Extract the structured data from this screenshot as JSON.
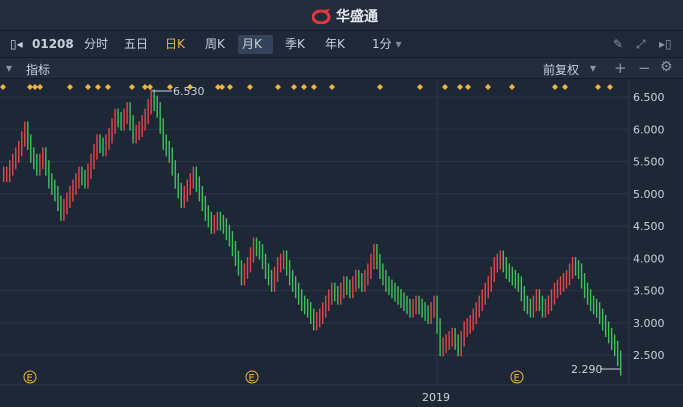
{
  "app": {
    "title": "华盛通"
  },
  "toolbar": {
    "code": "01208",
    "tabs": [
      {
        "label": "分时"
      },
      {
        "label": "五日"
      },
      {
        "label": "日K"
      },
      {
        "label": "周K"
      },
      {
        "label": "月K"
      },
      {
        "label": "季K"
      },
      {
        "label": "年K"
      }
    ],
    "interval": "1分",
    "active": "月K"
  },
  "indicator_bar": {
    "label": "指标",
    "adjust": "前复权"
  },
  "colors": {
    "up": "#e0474c",
    "down": "#3fbf5a",
    "marker": "#f0b43c",
    "bg": "#1e2736"
  },
  "chart_data": {
    "type": "candlestick",
    "y_ticks": [
      "6.500",
      "6.000",
      "5.500",
      "5.000",
      "4.500",
      "4.000",
      "3.500",
      "3.000",
      "2.500"
    ],
    "ylim": [
      2.2,
      6.6
    ],
    "x_label": "2019",
    "max_label": "6.530",
    "min_label": "2.290",
    "events": [
      "E",
      "E",
      "E"
    ],
    "closes": [
      5.3,
      5.5,
      5.7,
      6.0,
      5.6,
      5.4,
      5.6,
      5.2,
      5.0,
      4.7,
      4.9,
      5.1,
      5.3,
      5.2,
      5.5,
      5.8,
      5.7,
      5.9,
      6.2,
      6.1,
      6.3,
      5.9,
      6.0,
      6.2,
      6.5,
      6.3,
      5.8,
      5.6,
      5.2,
      4.9,
      5.1,
      5.3,
      5.0,
      4.7,
      4.5,
      4.6,
      4.5,
      4.3,
      4.0,
      3.7,
      3.9,
      4.2,
      4.1,
      3.8,
      3.6,
      3.9,
      4.0,
      3.7,
      3.5,
      3.3,
      3.2,
      3.0,
      3.1,
      3.3,
      3.5,
      3.4,
      3.6,
      3.5,
      3.7,
      3.6,
      3.8,
      4.1,
      3.8,
      3.6,
      3.5,
      3.4,
      3.3,
      3.2,
      3.3,
      3.2,
      3.1,
      3.3,
      2.6,
      2.7,
      2.8,
      2.6,
      2.9,
      3.0,
      3.2,
      3.4,
      3.6,
      3.9,
      4.0,
      3.8,
      3.7,
      3.6,
      3.3,
      3.2,
      3.4,
      3.2,
      3.3,
      3.5,
      3.6,
      3.7,
      3.9,
      3.8,
      3.5,
      3.3,
      3.2,
      3.0,
      2.8,
      2.6,
      2.3
    ]
  }
}
